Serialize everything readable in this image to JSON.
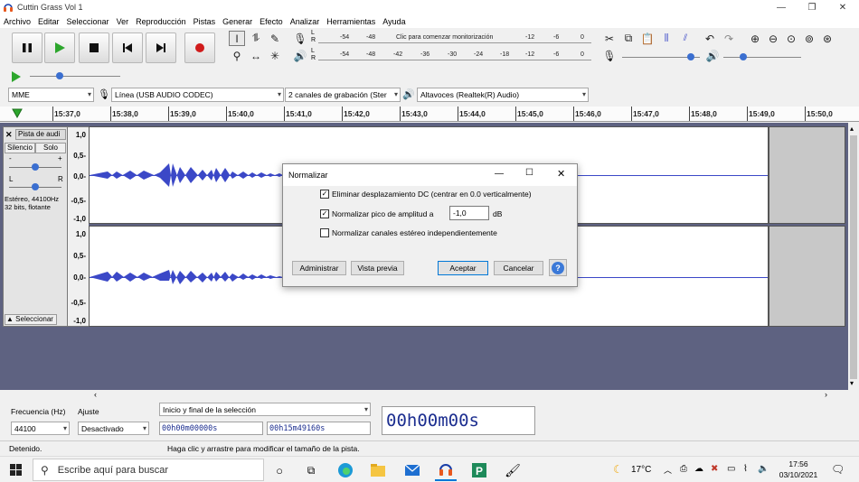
{
  "window": {
    "title": "Cuttin Grass Vol 1"
  },
  "menu": [
    "Archivo",
    "Editar",
    "Seleccionar",
    "Ver",
    "Reproducción",
    "Pistas",
    "Generar",
    "Efecto",
    "Analizar",
    "Herramientas",
    "Ayuda"
  ],
  "meters": {
    "record_scale": [
      "-54",
      "-48",
      "-12",
      "-6",
      "0"
    ],
    "record_prompt": "Clic para comenzar monitorización",
    "play_scale": [
      "-54",
      "-48",
      "-42",
      "-36",
      "-30",
      "-24",
      "-18",
      "-12",
      "-6",
      "0"
    ],
    "channel_l": "L",
    "channel_r": "R"
  },
  "devices": {
    "host": "MME",
    "input": "Línea (USB AUDIO  CODEC)",
    "channels": "2 canales de grabación (Ster",
    "output": "Altavoces (Realtek(R) Audio)"
  },
  "ruler": {
    "ticks": [
      "15:37,0",
      "15:38,0",
      "15:39,0",
      "15:40,0",
      "15:41,0",
      "15:42,0",
      "15:43,0",
      "15:44,0",
      "15:45,0",
      "15:46,0",
      "15:47,0",
      "15:48,0",
      "15:49,0",
      "15:50,0"
    ]
  },
  "track": {
    "name": "Pista de audi",
    "mute": "Silencio",
    "solo": "Solo",
    "gain_minus": "-",
    "gain_plus": "+",
    "pan_l": "L",
    "pan_r": "R",
    "info_line1": "Estéreo, 44100Hz",
    "info_line2": "32 bits, flotante",
    "select": "Seleccionar",
    "scale": [
      "1,0",
      "0,5-",
      "0,0-",
      "-0,5-",
      "-1,0"
    ]
  },
  "selection": {
    "rate_label": "Frecuencia (Hz)",
    "snap_label": "Ajuste",
    "mode_label": "Inicio y final de la selección",
    "rate_value": "44100",
    "snap_value": "Desactivado",
    "start": "00h00m00000s",
    "end": "00h15m49160s",
    "position": "00h00m00s"
  },
  "status": {
    "state": "Detenido.",
    "hint": "Haga clic y arrastre para modificar el tamaño de la pista."
  },
  "dialog": {
    "title": "Normalizar",
    "opt_dc": "Eliminar desplazamiento DC (centrar en 0.0 verticalmente)",
    "opt_dc_checked": true,
    "opt_peak": "Normalizar pico de amplitud a",
    "opt_peak_checked": true,
    "peak_value": "-1,0",
    "peak_unit": "dB",
    "opt_stereo": "Normalizar canales estéreo independientemente",
    "opt_stereo_checked": false,
    "manage": "Administrar",
    "preview": "Vista previa",
    "ok": "Aceptar",
    "cancel": "Cancelar",
    "help": "?"
  },
  "taskbar": {
    "search_placeholder": "Escribe aquí para buscar",
    "temperature": "17°C",
    "time": "17:56",
    "date": "03/10/2021"
  },
  "colors": {
    "accent": "#0078d7",
    "waveform": "#3b48c7",
    "track_bg": "#5e6281",
    "time_text": "#1b2d8f",
    "play_green": "#2da62d",
    "record_red": "#d01b1b"
  }
}
